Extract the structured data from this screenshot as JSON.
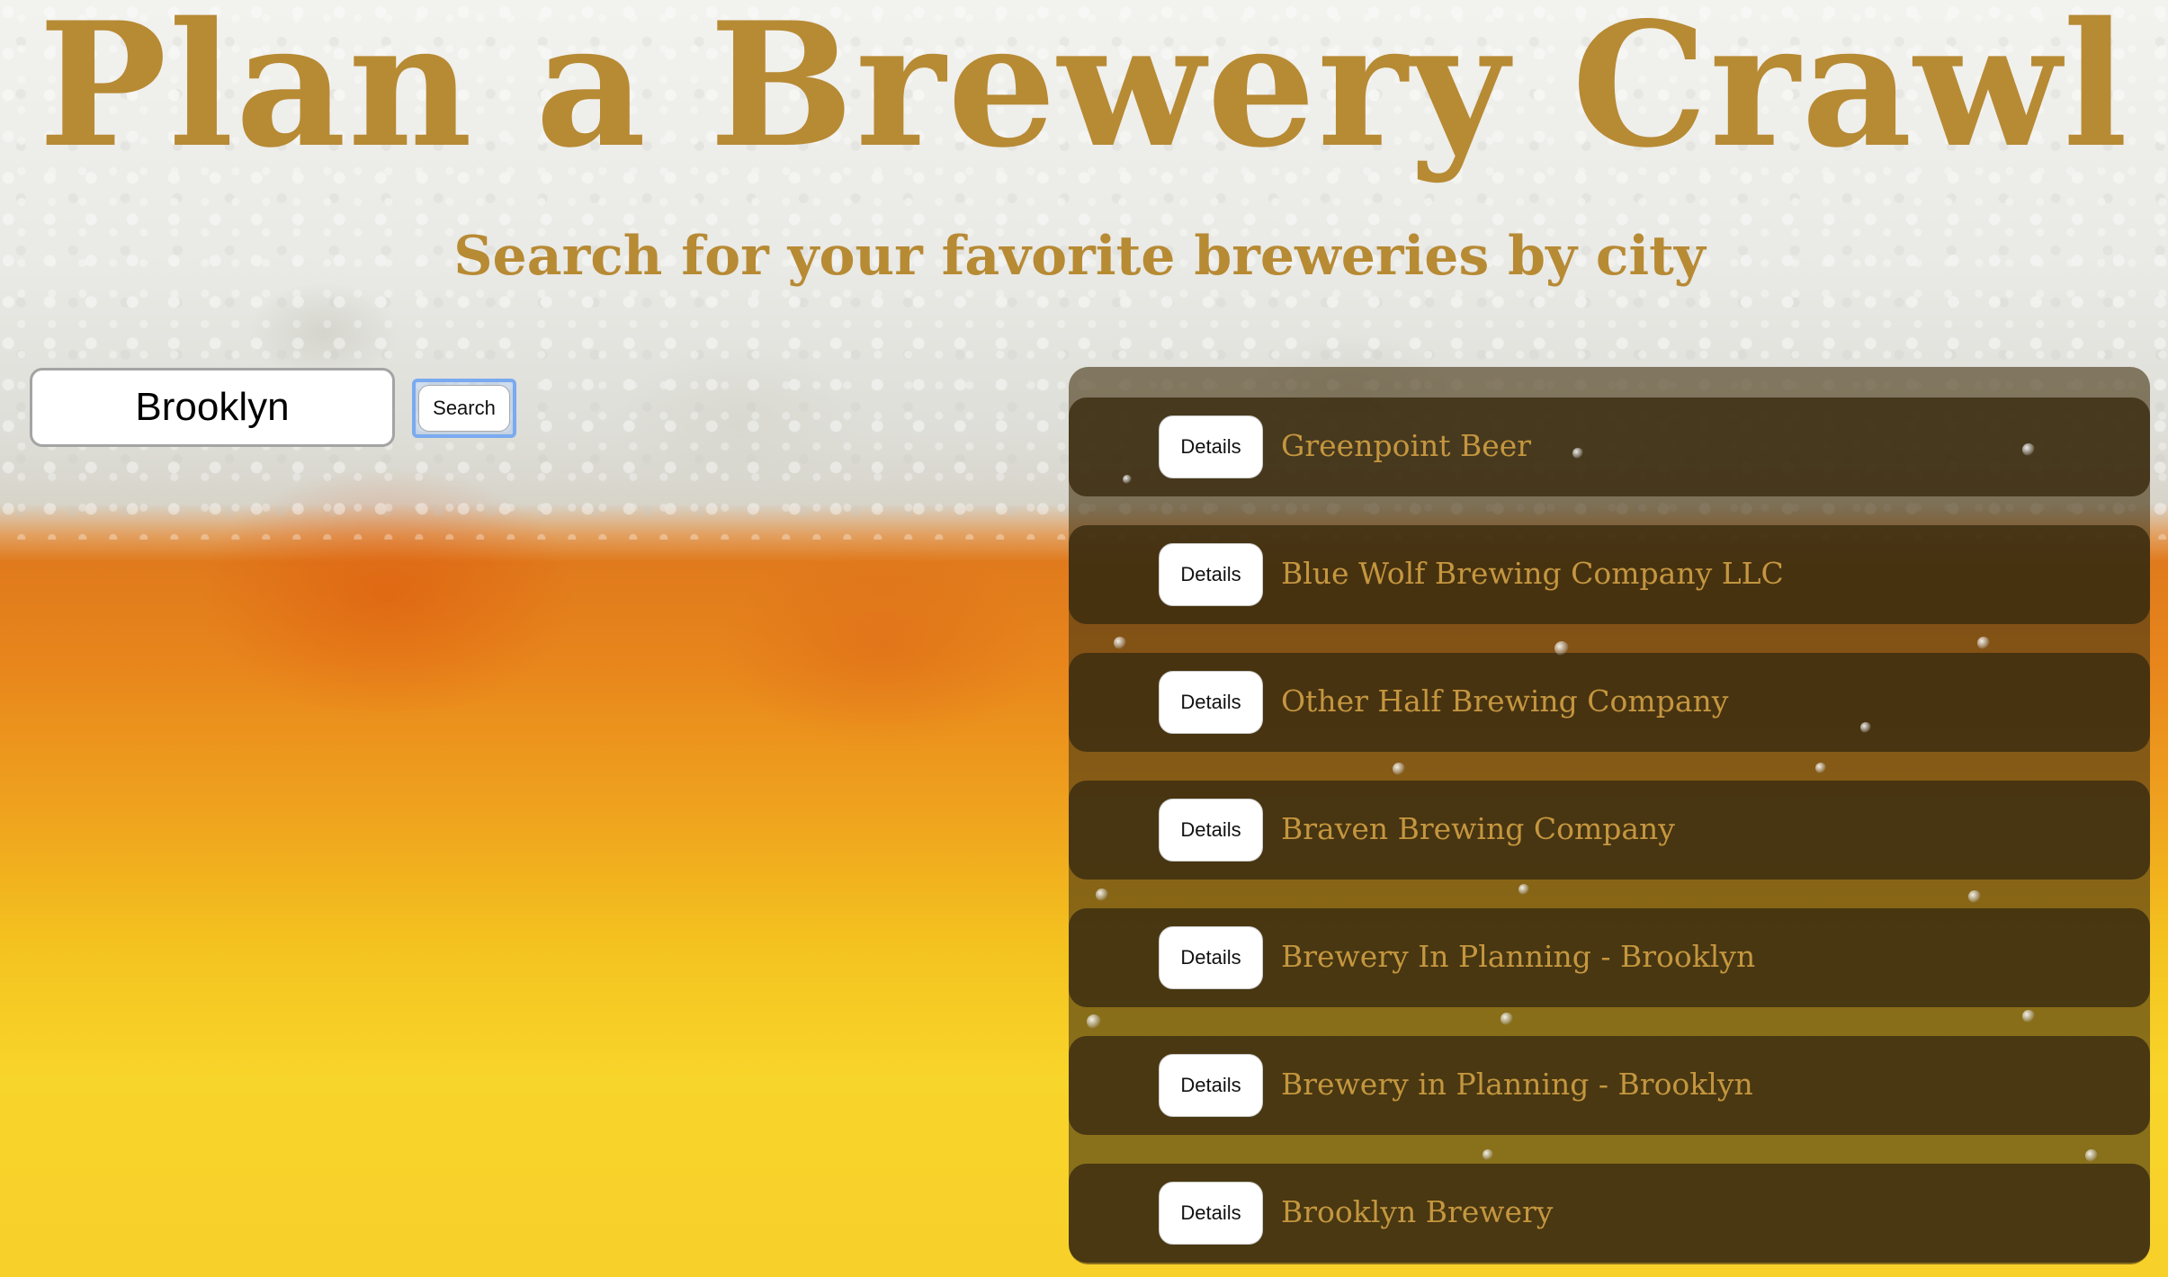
{
  "header": {
    "title": "Plan a Brewery Crawl",
    "subtitle": "Search for your favorite breweries by city"
  },
  "search": {
    "value": "Brooklyn",
    "button_label": "Search"
  },
  "results": [
    {
      "details_label": "Details",
      "name": "Greenpoint Beer"
    },
    {
      "details_label": "Details",
      "name": "Blue Wolf Brewing Company LLC"
    },
    {
      "details_label": "Details",
      "name": "Other Half Brewing Company"
    },
    {
      "details_label": "Details",
      "name": "Braven Brewing Company"
    },
    {
      "details_label": "Details",
      "name": "Brewery In Planning - Brooklyn"
    },
    {
      "details_label": "Details",
      "name": "Brewery in Planning - Brooklyn"
    },
    {
      "details_label": "Details",
      "name": "Brooklyn Brewery"
    }
  ],
  "colors": {
    "accent_gold": "#b78a34",
    "panel_brown": "#3a2c10",
    "focus_blue": "#7aaaf0"
  }
}
